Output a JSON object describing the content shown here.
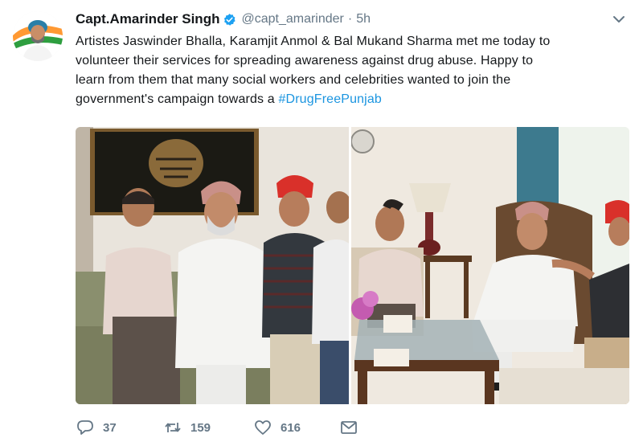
{
  "tweet": {
    "author_name": "Capt.Amarinder Singh",
    "handle": "@capt_amarinder",
    "separator": "·",
    "time": "5h",
    "text_lines": [
      "Artistes Jaswinder Bhalla, Karamjit Anmol & Bal Mukand Sharma met me today to",
      "volunteer their services for spreading awareness against drug abuse. Happy to",
      "learn from them that many social workers and celebrities wanted to join the",
      "government's campaign towards a "
    ],
    "hashtag": "#DrugFreePunjab",
    "reply_count": "37",
    "retweet_count": "159",
    "like_count": "616"
  },
  "icons": {
    "verified": "verified-badge-icon",
    "caret": "chevron-down-icon",
    "reply": "reply-icon",
    "retweet": "retweet-icon",
    "like": "heart-icon",
    "message": "envelope-icon"
  },
  "colors": {
    "link": "#1b95e0",
    "muted": "#657786",
    "verified": "#1da1f2"
  }
}
